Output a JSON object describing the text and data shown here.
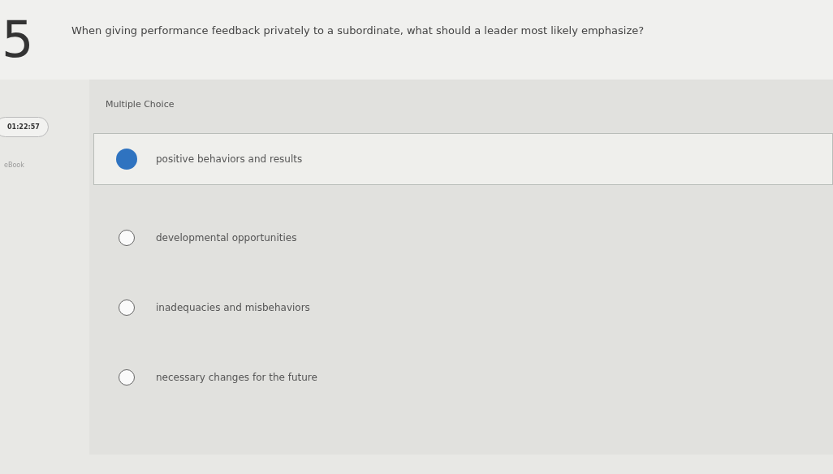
{
  "question": {
    "number": "5",
    "text": "When giving performance feedback privately to a subordinate, what should a leader most likely emphasize?"
  },
  "sidebar": {
    "timer": "01:22:57",
    "ebook": "eBook"
  },
  "type_label": "Multiple Choice",
  "options": [
    {
      "label": "positive behaviors and results",
      "selected": true
    },
    {
      "label": "developmental opportunities",
      "selected": false
    },
    {
      "label": "inadequacies and misbehaviors",
      "selected": false
    },
    {
      "label": "necessary changes for the future",
      "selected": false
    }
  ]
}
